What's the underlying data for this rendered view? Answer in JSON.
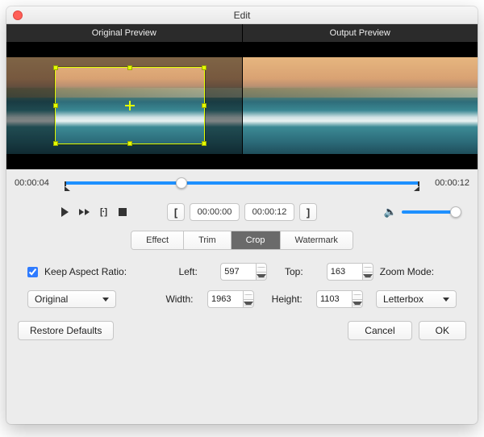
{
  "window": {
    "title": "Edit"
  },
  "preview": {
    "original_label": "Original Preview",
    "output_label": "Output Preview"
  },
  "timeline": {
    "current": "00:00:04",
    "end": "00:00:12",
    "in_time": "00:00:00",
    "out_time": "00:00:12"
  },
  "tabs": {
    "effect": "Effect",
    "trim": "Trim",
    "crop": "Crop",
    "watermark": "Watermark",
    "active": "crop"
  },
  "crop": {
    "keep_aspect_label": "Keep Aspect Ratio:",
    "keep_aspect_checked": true,
    "left_label": "Left:",
    "left": "597",
    "top_label": "Top:",
    "top": "163",
    "width_label": "Width:",
    "width": "1963",
    "height_label": "Height:",
    "height": "1103",
    "aspect_select": "Original",
    "zoom_label": "Zoom Mode:",
    "zoom_select": "Letterbox"
  },
  "footer": {
    "restore": "Restore Defaults",
    "cancel": "Cancel",
    "ok": "OK"
  }
}
